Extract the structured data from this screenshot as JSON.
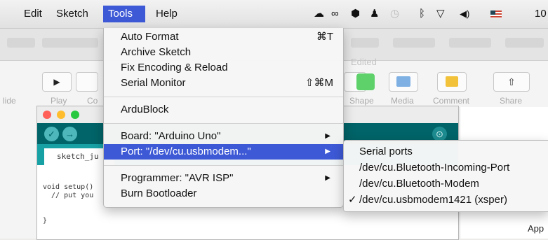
{
  "menubar": {
    "menus": [
      "Edit",
      "Sketch",
      "Tools",
      "Help"
    ],
    "active_menu": "Tools",
    "tray_icons": [
      "creative-cloud-icon",
      "link-icon",
      "hexagon-icon",
      "bell-icon",
      "time-machine-icon",
      "bluetooth-icon",
      "wifi-icon",
      "volume-icon",
      "us-flag-icon"
    ],
    "clock_fragment": "10"
  },
  "tools_menu": {
    "items": [
      {
        "label": "Auto Format",
        "shortcut": "⌘T"
      },
      {
        "label": "Archive Sketch"
      },
      {
        "label": "Fix Encoding & Reload"
      },
      {
        "label": "Serial Monitor",
        "shortcut": "⇧⌘M"
      },
      {
        "label": "ArduBlock"
      },
      {
        "label": "Board: \"Arduino Uno\"",
        "submenu": true
      },
      {
        "label": "Port: \"/dev/cu.usbmodem...\"",
        "submenu": true,
        "highlighted": true
      },
      {
        "label": "Programmer: \"AVR ISP\"",
        "submenu": true
      },
      {
        "label": "Burn Bootloader"
      }
    ],
    "submenu_arrow": "▶"
  },
  "port_submenu": {
    "header": "Serial ports",
    "items": [
      {
        "label": "/dev/cu.Bluetooth-Incoming-Port",
        "checked": false
      },
      {
        "label": "/dev/cu.Bluetooth-Modem",
        "checked": false
      },
      {
        "label": "/dev/cu.usbmodem1421 (xsper)",
        "checked": true
      }
    ],
    "check_mark": "✓"
  },
  "keynote": {
    "edited_label": "Edited",
    "toolbar_labels": [
      "lide",
      "Play",
      "Co",
      "Shape",
      "Media",
      "Comment",
      "Share"
    ],
    "play_glyph": "▶",
    "share_glyph": "⇧",
    "partial_text": "App"
  },
  "arduino": {
    "tab_label": "sketch_ju",
    "code_lines": [
      "void setup()",
      "  // put you",
      "",
      "}"
    ],
    "toolbar_glyphs": [
      "✓",
      "→"
    ],
    "serial_glyph": "⊙"
  },
  "colors": {
    "highlight": "#3d59d6",
    "arduino_teal": "#006468",
    "arduino_tab": "#17a1a5"
  }
}
